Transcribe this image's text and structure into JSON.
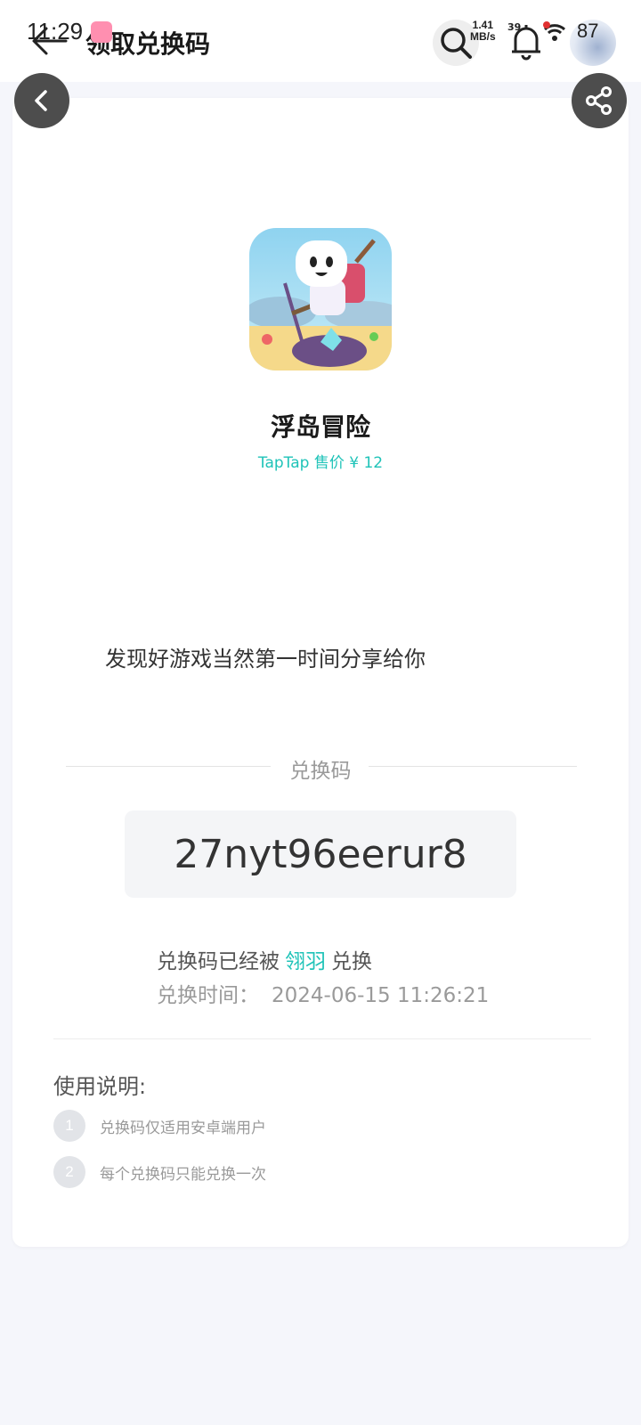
{
  "status_bar": {
    "time": "11:29",
    "net_speed_value": "1.41",
    "net_speed_unit": "MB/s",
    "signal_label": "39",
    "battery": "87"
  },
  "header": {
    "title": "领取兑换码"
  },
  "game": {
    "name": "浮岛冒险",
    "price": "TapTap 售价 ¥ 12"
  },
  "share_message": "发现好游戏当然第一时间分享给你",
  "code_section": {
    "label": "兑换码",
    "code": "27nyt96eerur8",
    "redeemed_prefix": "兑换码已经被",
    "redeemed_user": "翎羽",
    "redeemed_suffix": "兑换",
    "time_label": "兑换时间：",
    "time_value": "2024-06-15 11:26:21"
  },
  "instructions": {
    "title": "使用说明:",
    "items": [
      {
        "num": "1",
        "text": "兑换码仅适用安卓端用户"
      },
      {
        "num": "2",
        "text": "每个兑换码只能兑换一次"
      }
    ]
  },
  "colors": {
    "accent": "#1fc3b8",
    "button_dark": "#4d4d4d",
    "background": "#f5f6fb"
  }
}
